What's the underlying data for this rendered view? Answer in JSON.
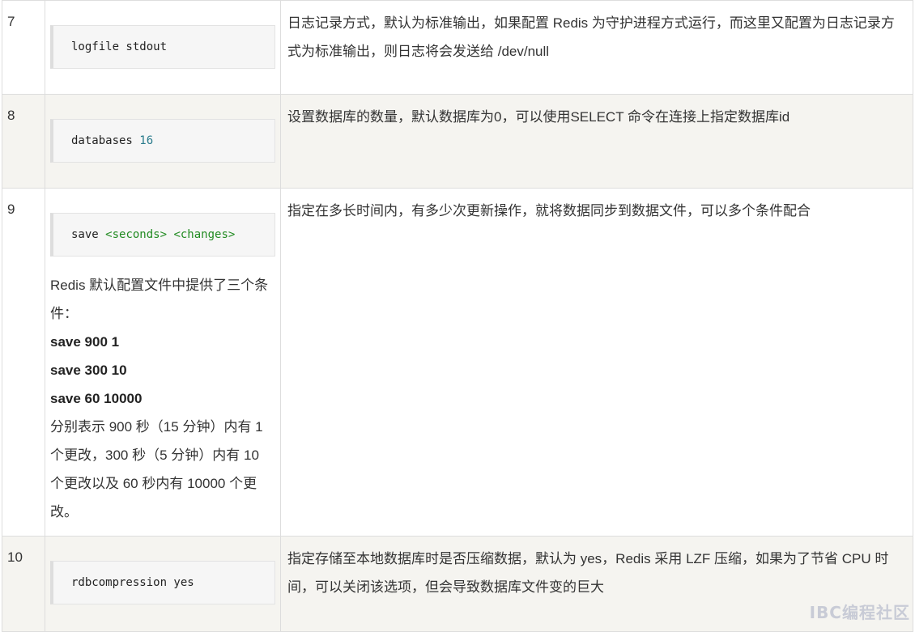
{
  "rows": [
    {
      "num": "7",
      "code_keyword": "logfile stdout",
      "description": "日志记录方式，默认为标准输出，如果配置 Redis 为守护进程方式运行，而这里又配置为日志记录方式为标准输出，则日志将会发送给 /dev/null"
    },
    {
      "num": "8",
      "code_keyword": "databases ",
      "code_value": "16",
      "description": "设置数据库的数量，默认数据库为0，可以使用SELECT 命令在连接上指定数据库id"
    },
    {
      "num": "9",
      "code_keyword": "save ",
      "code_args": "<seconds> <changes>",
      "note_intro": "Redis 默认配置文件中提供了三个条件：",
      "note_lines": [
        "save 900 1",
        "save 300 10",
        "save 60 10000"
      ],
      "note_explain": "分别表示 900 秒（15 分钟）内有 1 个更改，300 秒（5 分钟）内有 10 个更改以及 60 秒内有 10000 个更改。",
      "description": "指定在多长时间内，有多少次更新操作，就将数据同步到数据文件，可以多个条件配合"
    },
    {
      "num": "10",
      "code_keyword": "rdbcompression yes",
      "description": "指定存储至本地数据库时是否压缩数据，默认为 yes，Redis 采用 LZF 压缩，如果为了节省 CPU 时间，可以关闭该选项，但会导致数据库文件变的巨大"
    }
  ],
  "watermark": "IBC编程社区"
}
